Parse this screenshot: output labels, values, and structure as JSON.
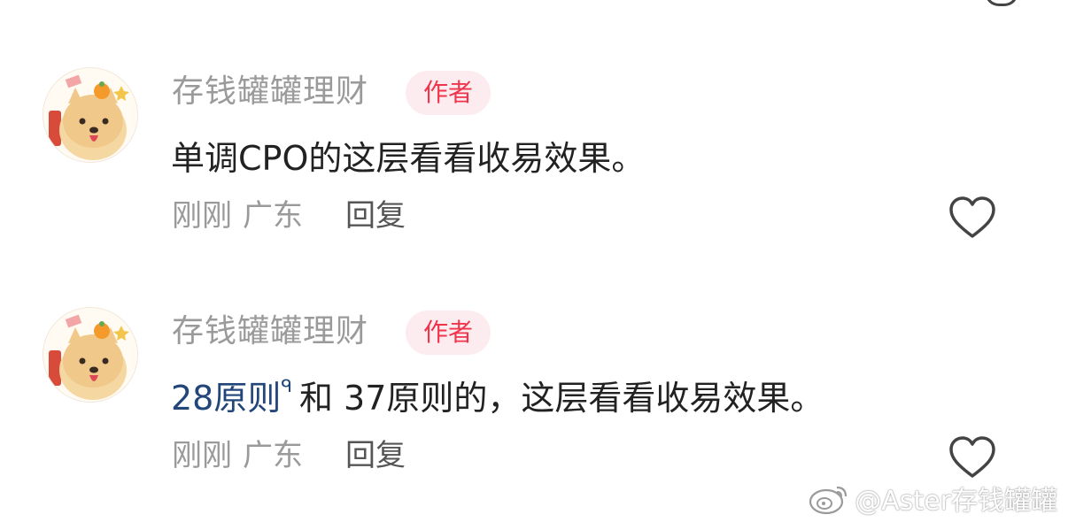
{
  "comments": [
    {
      "username": "存钱罐罐理财",
      "badge": "作者",
      "text": "单调CPO的这层看看收易效果。",
      "time": "刚刚",
      "location": "广东",
      "reply_label": "回复"
    },
    {
      "username": "存钱罐罐理财",
      "badge": "作者",
      "link_text": "28原则",
      "search_mark": "ᑫ",
      "text_rest": "和 37原则的，这层看看收易效果。",
      "time": "刚刚",
      "location": "广东",
      "reply_label": "回复"
    }
  ],
  "icons": {
    "like": "heart-outline-icon",
    "avatar": "shiba-dog-avatar",
    "watermark": "weibo-logo-icon"
  },
  "colors": {
    "username": "#9a9a9a",
    "badge_text": "#f0344b",
    "badge_bg": "#fdecef",
    "body_text": "#222222",
    "link": "#22467a",
    "meta": "#9a9a9a"
  },
  "watermark": {
    "text": "@Aster存钱罐罐"
  }
}
